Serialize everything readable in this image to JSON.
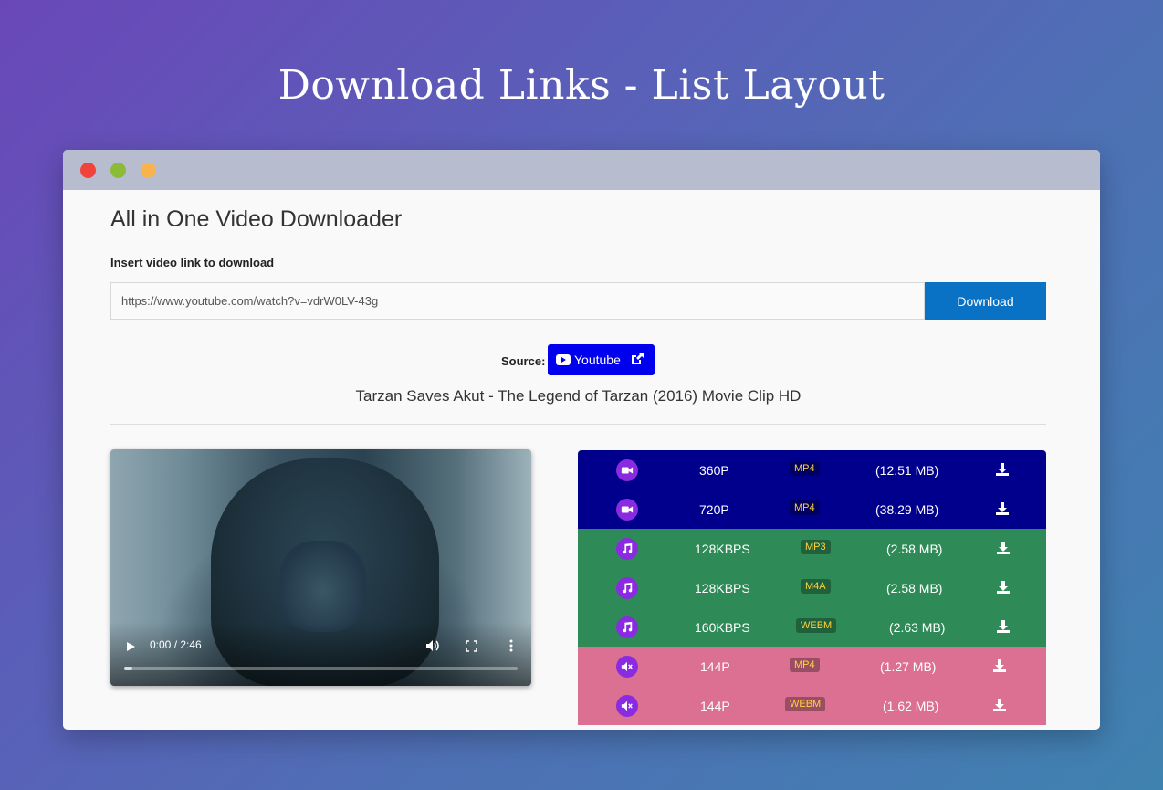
{
  "page": {
    "heading": "Download Links - List Layout"
  },
  "app": {
    "title": "All in One Video Downloader",
    "input_label": "Insert video link to download",
    "url_value": "https://www.youtube.com/watch?v=vdrW0LV-43g",
    "download_label": "Download",
    "source_label": "Source:",
    "source_name": "Youtube",
    "video_title": "Tarzan Saves Akut - The Legend of Tarzan (2016) Movie Clip HD"
  },
  "player": {
    "time": "0:00 / 2:46",
    "progress_fraction": 0.02
  },
  "colors": {
    "video_row": "#00008d",
    "audio_row": "#2e8b57",
    "mute_row": "#db7093",
    "accent_button": "#0a72c4",
    "source_button": "#0000ee",
    "type_circle": "#8a2be2"
  },
  "links": [
    {
      "kind": "video",
      "icon": "video-camera-icon",
      "quality": "360P",
      "format": "MP4",
      "size": "(12.51 MB)"
    },
    {
      "kind": "video",
      "icon": "video-camera-icon",
      "quality": "720P",
      "format": "MP4",
      "size": "(38.29 MB)"
    },
    {
      "kind": "audio",
      "icon": "music-note-icon",
      "quality": "128KBPS",
      "format": "MP3",
      "size": "(2.58 MB)"
    },
    {
      "kind": "audio",
      "icon": "music-note-icon",
      "quality": "128KBPS",
      "format": "M4A",
      "size": "(2.58 MB)"
    },
    {
      "kind": "audio",
      "icon": "music-note-icon",
      "quality": "160KBPS",
      "format": "WEBM",
      "size": "(2.63 MB)"
    },
    {
      "kind": "mute",
      "icon": "volume-mute-icon",
      "quality": "144P",
      "format": "MP4",
      "size": "(1.27 MB)"
    },
    {
      "kind": "mute",
      "icon": "volume-mute-icon",
      "quality": "144P",
      "format": "WEBM",
      "size": "(1.62 MB)"
    }
  ]
}
